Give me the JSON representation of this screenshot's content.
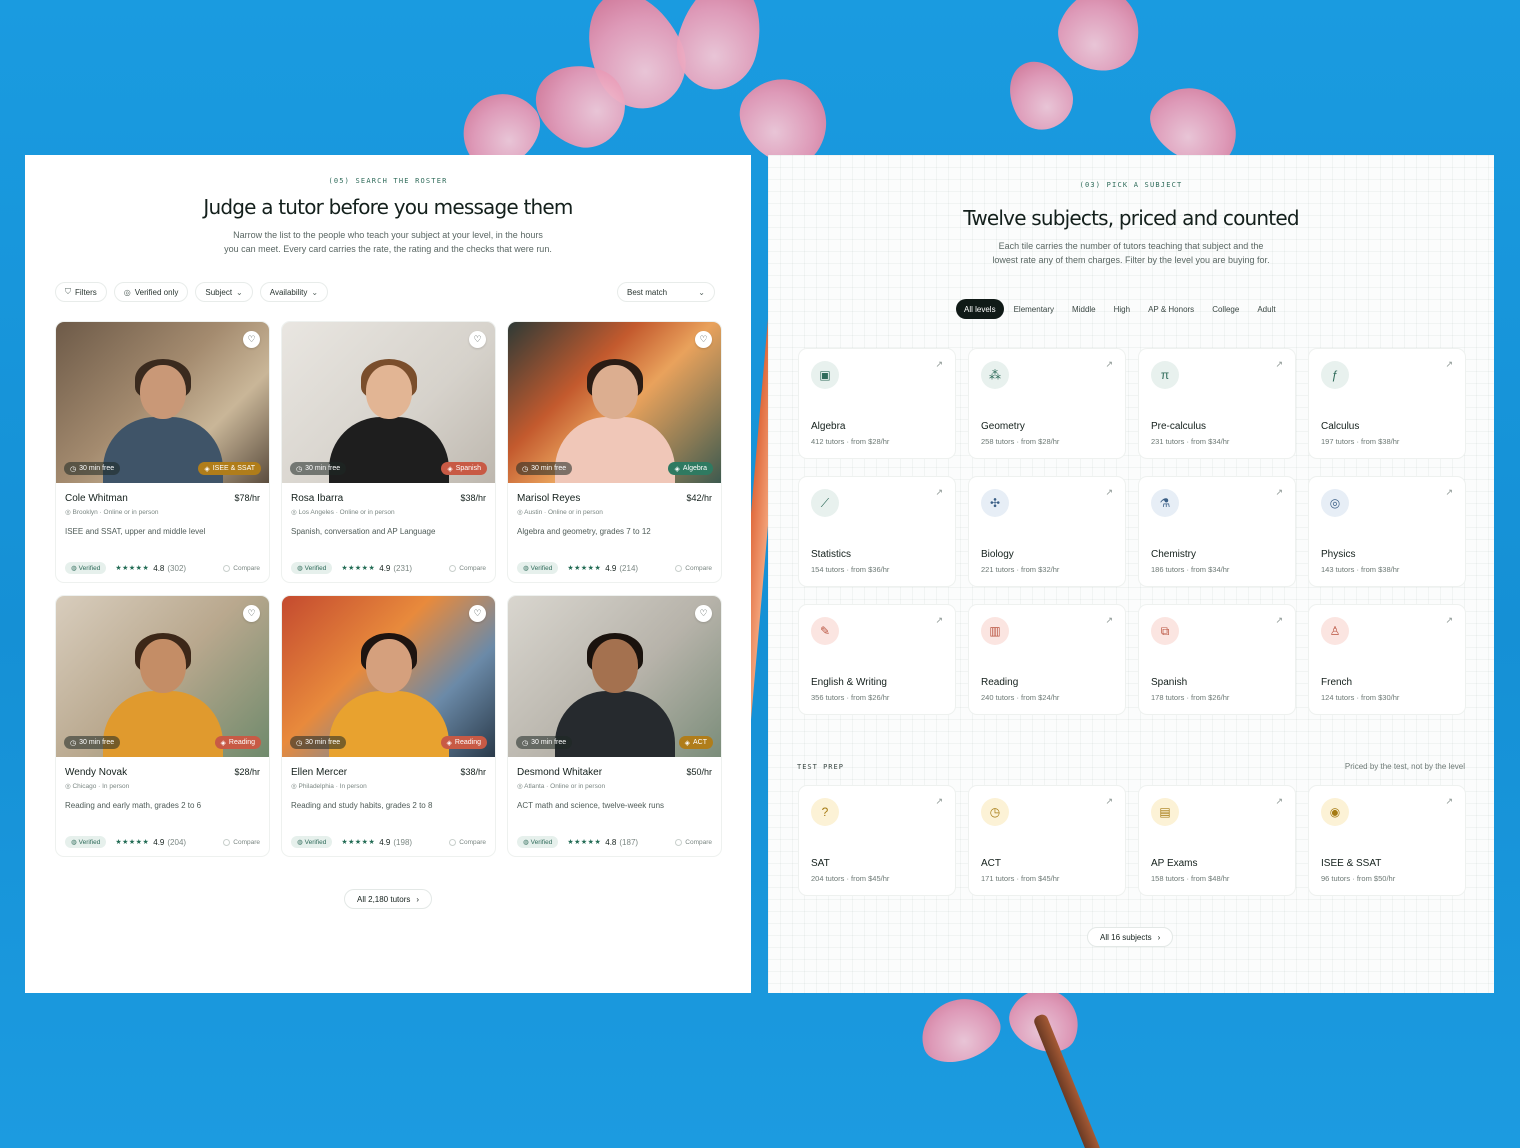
{
  "left": {
    "eyebrow": "(05)  SEARCH THE ROSTER",
    "title": "Judge a tutor before you message them",
    "lede_1": "Narrow the list to the people who teach your subject at your level, in the hours",
    "lede_2": "you can meet. Every card carries the rate, the rating and the checks that were run.",
    "filters": {
      "filters_label": "Filters",
      "verified_label": "Verified only",
      "subject_label": "Subject",
      "availability_label": "Availability",
      "sort_label": "Best match"
    },
    "free_label": "30 min free",
    "verified_label": "Verified",
    "compare_label": "Compare",
    "stars": "★★★★★",
    "tutors": [
      {
        "name": "Cole Whitman",
        "price": "$78/hr",
        "location": "Brooklyn · Online or in person",
        "desc": "ISEE and SSAT, upper and middle level",
        "rating": "4.8",
        "count": "(302)",
        "subject": "ISEE & SSAT",
        "subject_color": "#b07d1a"
      },
      {
        "name": "Rosa Ibarra",
        "price": "$38/hr",
        "location": "Los Angeles · Online or in person",
        "desc": "Spanish, conversation and AP Language",
        "rating": "4.9",
        "count": "(231)",
        "subject": "Spanish",
        "subject_color": "#c85a45"
      },
      {
        "name": "Marisol Reyes",
        "price": "$42/hr",
        "location": "Austin · Online or in person",
        "desc": "Algebra and geometry, grades 7 to 12",
        "rating": "4.9",
        "count": "(214)",
        "subject": "Algebra",
        "subject_color": "#2f7a61"
      },
      {
        "name": "Wendy Novak",
        "price": "$28/hr",
        "location": "Chicago · In person",
        "desc": "Reading and early math, grades 2 to 6",
        "rating": "4.9",
        "count": "(204)",
        "subject": "Reading",
        "subject_color": "#c85a45"
      },
      {
        "name": "Ellen Mercer",
        "price": "$38/hr",
        "location": "Philadelphia · In person",
        "desc": "Reading and study habits, grades 2 to 8",
        "rating": "4.9",
        "count": "(198)",
        "subject": "Reading",
        "subject_color": "#c85a45"
      },
      {
        "name": "Desmond Whitaker",
        "price": "$50/hr",
        "location": "Atlanta · Online or in person",
        "desc": "ACT math and science, twelve-week runs",
        "rating": "4.8",
        "count": "(187)",
        "subject": "ACT",
        "subject_color": "#b07d1a"
      }
    ],
    "all_tutors": "All 2,180 tutors"
  },
  "right": {
    "eyebrow": "(03)  PICK A SUBJECT",
    "title": "Twelve subjects, priced and counted",
    "lede_1": "Each tile carries the number of tutors teaching that subject and the",
    "lede_2": "lowest rate any of them charges. Filter by the level you are buying for.",
    "levels": [
      "All levels",
      "Elementary",
      "Middle",
      "High",
      "AP & Honors",
      "College",
      "Adult"
    ],
    "subjects": [
      {
        "name": "Algebra",
        "meta": "412 tutors · from $28/hr",
        "icon": "▣",
        "kind": "math"
      },
      {
        "name": "Geometry",
        "meta": "258 tutors · from $28/hr",
        "icon": "⁂",
        "kind": "math"
      },
      {
        "name": "Pre-calculus",
        "meta": "231 tutors · from $34/hr",
        "icon": "π",
        "kind": "math"
      },
      {
        "name": "Calculus",
        "meta": "197 tutors · from $38/hr",
        "icon": "ƒ",
        "kind": "math"
      },
      {
        "name": "Statistics",
        "meta": "154 tutors · from $36/hr",
        "icon": "⟋",
        "kind": "math"
      },
      {
        "name": "Biology",
        "meta": "221 tutors · from $32/hr",
        "icon": "✣",
        "kind": "sci"
      },
      {
        "name": "Chemistry",
        "meta": "186 tutors · from $34/hr",
        "icon": "⚗",
        "kind": "sci"
      },
      {
        "name": "Physics",
        "meta": "143 tutors · from $38/hr",
        "icon": "◎",
        "kind": "sci"
      },
      {
        "name": "English & Writing",
        "meta": "356 tutors · from $26/hr",
        "icon": "✎",
        "kind": "lang"
      },
      {
        "name": "Reading",
        "meta": "240 tutors · from $24/hr",
        "icon": "▥",
        "kind": "lang"
      },
      {
        "name": "Spanish",
        "meta": "178 tutors · from $26/hr",
        "icon": "⧉",
        "kind": "lang"
      },
      {
        "name": "French",
        "meta": "124 tutors · from $30/hr",
        "icon": "♙",
        "kind": "lang"
      }
    ],
    "test_prep_label": "TEST PREP",
    "test_prep_note": "Priced by the test, not by the level",
    "tests": [
      {
        "name": "SAT",
        "meta": "204 tutors · from $45/hr",
        "icon": "?",
        "kind": "test"
      },
      {
        "name": "ACT",
        "meta": "171 tutors · from $45/hr",
        "icon": "◷",
        "kind": "test"
      },
      {
        "name": "AP Exams",
        "meta": "158 tutors · from $48/hr",
        "icon": "▤",
        "kind": "test"
      },
      {
        "name": "ISEE & SSAT",
        "meta": "96 tutors · from $50/hr",
        "icon": "◉",
        "kind": "test"
      }
    ],
    "all_subjects": "All 16 subjects"
  }
}
